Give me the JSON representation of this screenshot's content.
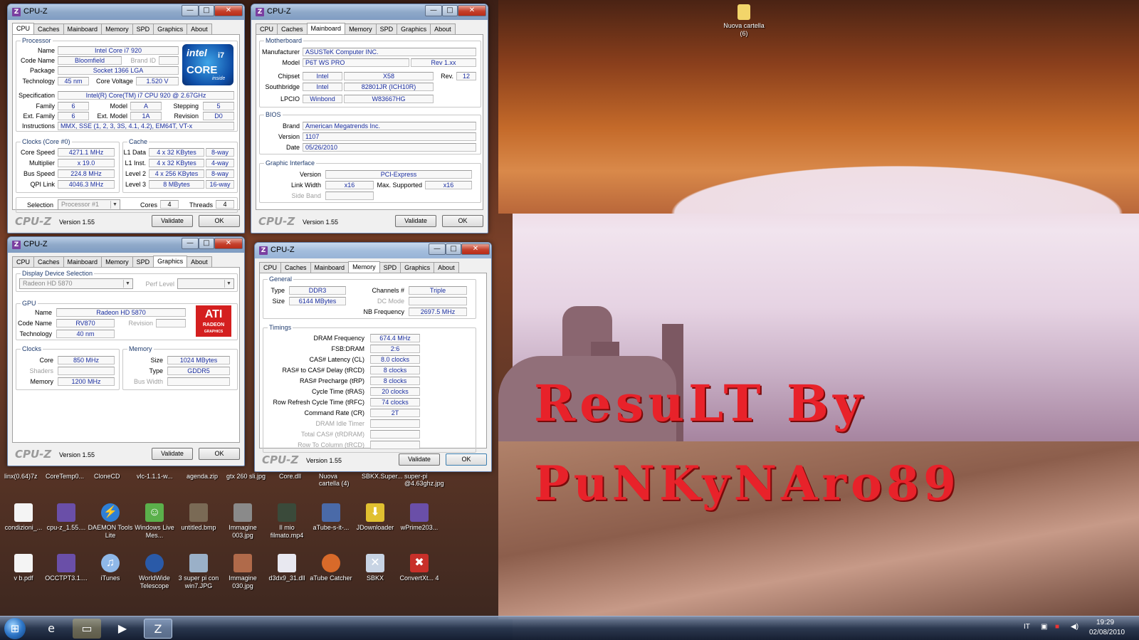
{
  "desktop": {
    "folder_top": "Nuova cartella (6)",
    "overlay_line1": "ResuLT By",
    "overlay_line2": "PuNKyNAro89",
    "icons_top_labels": [
      "linx(0.64)7z",
      "CoreTemp0...",
      "CloneCD",
      "vlc-1.1.1-w...",
      "agenda.zip",
      "gtx 260 sli.jpg",
      "Core.dll",
      "Nuova cartella (4)",
      "SBKX.Super...",
      "super-pi @4.63ghz.jpg"
    ],
    "icons_row1": [
      {
        "label": "condizioni_...",
        "icon": "document-icon"
      },
      {
        "label": "cpu-z_1.55....",
        "icon": "archive-icon"
      },
      {
        "label": "DAEMON Tools Lite",
        "icon": "daemon-icon"
      },
      {
        "label": "Windows Live Mes...",
        "icon": "messenger-icon"
      },
      {
        "label": "untitled.bmp",
        "icon": "image-icon"
      },
      {
        "label": "Immagine 003.jpg",
        "icon": "image-icon"
      },
      {
        "label": "Il mio filmato.mp4",
        "icon": "video-icon"
      },
      {
        "label": "aTube-s-it-...",
        "icon": "installer-icon"
      },
      {
        "label": "JDownloader",
        "icon": "download-icon"
      },
      {
        "label": "wPrime203...",
        "icon": "archive-icon"
      }
    ],
    "icons_row2": [
      {
        "label": "v b.pdf",
        "icon": "document-icon"
      },
      {
        "label": "OCCTPT3.1....",
        "icon": "archive-icon"
      },
      {
        "label": "iTunes",
        "icon": "itunes-icon"
      },
      {
        "label": "WorldWide Telescope",
        "icon": "telescope-icon"
      },
      {
        "label": "3 super pi con win7.JPG",
        "icon": "image-icon"
      },
      {
        "label": "Immagine 030.jpg",
        "icon": "image-icon"
      },
      {
        "label": "d3dx9_31.dll",
        "icon": "dll-icon"
      },
      {
        "label": "aTube Catcher",
        "icon": "atube-icon"
      },
      {
        "label": "SBKX",
        "icon": "sbkx-icon"
      },
      {
        "label": "ConvertXt... 4",
        "icon": "convert-icon"
      }
    ]
  },
  "common": {
    "title": "CPU-Z",
    "brand": "CPU-Z",
    "version": "Version 1.55",
    "validate": "Validate",
    "ok": "OK",
    "min": "—",
    "max": "□",
    "close": "✕",
    "tabs": [
      "CPU",
      "Caches",
      "Mainboard",
      "Memory",
      "SPD",
      "Graphics",
      "About"
    ]
  },
  "cpu": {
    "processor_group": "Processor",
    "name_l": "Name",
    "name": "Intel Core i7 920",
    "codename_l": "Code Name",
    "codename": "Bloomfield",
    "brandid_l": "Brand ID",
    "package_l": "Package",
    "package": "Socket 1366 LGA",
    "tech_l": "Technology",
    "tech": "45 nm",
    "voltage_l": "Core Voltage",
    "voltage": "1.520 V",
    "spec_l": "Specification",
    "spec": "Intel(R) Core(TM) i7 CPU       920  @ 2.67GHz",
    "family_l": "Family",
    "family": "6",
    "model_l": "Model",
    "model": "A",
    "stepping_l": "Stepping",
    "stepping": "5",
    "extfamily_l": "Ext. Family",
    "extfamily": "6",
    "extmodel_l": "Ext. Model",
    "extmodel": "1A",
    "revision_l": "Revision",
    "revision": "D0",
    "instr_l": "Instructions",
    "instr": "MMX, SSE (1, 2, 3, 3S, 4.1, 4.2), EM64T, VT-x",
    "clocks_group": "Clocks (Core #0)",
    "corespeed_l": "Core Speed",
    "corespeed": "4271.1 MHz",
    "mult_l": "Multiplier",
    "mult": "x 19.0",
    "bus_l": "Bus Speed",
    "bus": "224.8 MHz",
    "qpi_l": "QPI Link",
    "qpi": "4046.3 MHz",
    "cache_group": "Cache",
    "l1d_l": "L1 Data",
    "l1d": "4 x 32 KBytes",
    "l1d_w": "8-way",
    "l1i_l": "L1 Inst.",
    "l1i": "4 x 32 KBytes",
    "l1i_w": "4-way",
    "l2_l": "Level 2",
    "l2": "4 x 256 KBytes",
    "l2_w": "8-way",
    "l3_l": "Level 3",
    "l3": "8 MBytes",
    "l3_w": "16-way",
    "selection_l": "Selection",
    "selection": "Processor #1",
    "cores_l": "Cores",
    "cores": "4",
    "threads_l": "Threads",
    "threads": "4",
    "logo_brand": "intel",
    "logo_model": "CORE",
    "logo_gen": "i7",
    "logo_inside": "inside"
  },
  "mainboard": {
    "mb_group": "Motherboard",
    "manuf_l": "Manufacturer",
    "manuf": "ASUSTeK Computer INC.",
    "model_l": "Model",
    "model": "P6T WS PRO",
    "model_rev": "Rev 1.xx",
    "chipset_l": "Chipset",
    "chipset_v": "Intel",
    "chipset": "X58",
    "rev_l": "Rev.",
    "rev": "12",
    "south_l": "Southbridge",
    "south_v": "Intel",
    "south": "82801JR (ICH10R)",
    "lpcio_l": "LPCIO",
    "lpcio_v": "Winbond",
    "lpcio": "W83667HG",
    "bios_group": "BIOS",
    "brand_l": "Brand",
    "brand": "American Megatrends Inc.",
    "version_l": "Version",
    "version": "1107",
    "date_l": "Date",
    "date": "05/26/2010",
    "gi_group": "Graphic Interface",
    "giver_l": "Version",
    "giver": "PCI-Express",
    "lw_l": "Link Width",
    "lw": "x16",
    "maxsup_l": "Max. Supported",
    "maxsup": "x16",
    "sideband_l": "Side Band"
  },
  "graphics": {
    "dds_group": "Display Device Selection",
    "device": "Radeon HD 5870",
    "perf_l": "Perf Level",
    "gpu_group": "GPU",
    "name_l": "Name",
    "name": "Radeon HD 5870",
    "codename_l": "Code Name",
    "codename": "RV870",
    "revision_l": "Revision",
    "tech_l": "Technology",
    "tech": "40 nm",
    "clocks_group": "Clocks",
    "core_l": "Core",
    "core": "850 MHz",
    "shaders_l": "Shaders",
    "memory_l": "Memory",
    "memory": "1200 MHz",
    "mem_group": "Memory",
    "size_l": "Size",
    "size": "1024 MBytes",
    "type_l": "Type",
    "type": "GDDR5",
    "buswidth_l": "Bus Width",
    "logo_ati": "ATI",
    "logo_radeon": "RADEON",
    "logo_graphics": "GRAPHICS"
  },
  "memory": {
    "general_group": "General",
    "type_l": "Type",
    "type": "DDR3",
    "size_l": "Size",
    "size": "6144 MBytes",
    "channels_l": "Channels #",
    "channels": "Triple",
    "dcmode_l": "DC Mode",
    "nbfreq_l": "NB Frequency",
    "nbfreq": "2697.5 MHz",
    "timings_group": "Timings",
    "timings": [
      {
        "label": "DRAM Frequency",
        "value": "674.4 MHz",
        "dim": false
      },
      {
        "label": "FSB:DRAM",
        "value": "2:6",
        "dim": false
      },
      {
        "label": "CAS# Latency (CL)",
        "value": "8.0 clocks",
        "dim": false
      },
      {
        "label": "RAS# to CAS# Delay (tRCD)",
        "value": "8 clocks",
        "dim": false
      },
      {
        "label": "RAS# Precharge (tRP)",
        "value": "8 clocks",
        "dim": false
      },
      {
        "label": "Cycle Time (tRAS)",
        "value": "20 clocks",
        "dim": false
      },
      {
        "label": "Row Refresh Cycle Time (tRFC)",
        "value": "74 clocks",
        "dim": false
      },
      {
        "label": "Command Rate (CR)",
        "value": "2T",
        "dim": false
      },
      {
        "label": "DRAM Idle Timer",
        "value": "",
        "dim": true
      },
      {
        "label": "Total CAS# (tRDRAM)",
        "value": "",
        "dim": true
      },
      {
        "label": "Row To Column (tRCD)",
        "value": "",
        "dim": true
      }
    ]
  },
  "taskbar": {
    "start_icon": "windows-start-icon",
    "lang": "IT",
    "time": "19:29",
    "date": "02/08/2010"
  }
}
